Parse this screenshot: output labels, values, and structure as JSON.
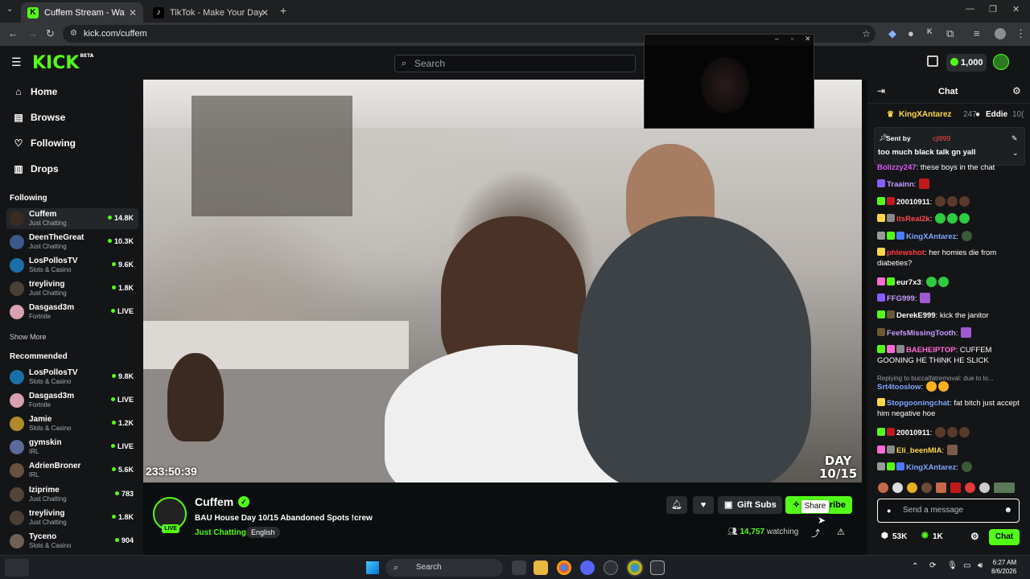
{
  "browser": {
    "tabs": [
      {
        "title": "Cuffem Stream - Watch Live",
        "active": true
      },
      {
        "title": "TikTok - Make Your Day",
        "active": false
      }
    ],
    "url": "kick.com/cuffem"
  },
  "header": {
    "logo": "KICK",
    "logo_tag": "BETA",
    "search_placeholder": "Search",
    "balance": "1,000"
  },
  "sidebar": {
    "nav": [
      {
        "label": "Home",
        "icon": "home-icon"
      },
      {
        "label": "Browse",
        "icon": "browse-icon"
      },
      {
        "label": "Following",
        "icon": "heart-icon"
      },
      {
        "label": "Drops",
        "icon": "drops-icon"
      }
    ],
    "following_title": "Following",
    "following": [
      {
        "name": "Cuffem",
        "category": "Just Chatting",
        "viewers": "14.8K"
      },
      {
        "name": "DeenTheGreat",
        "category": "Just Chatting",
        "viewers": "10.3K"
      },
      {
        "name": "LosPollosTV",
        "category": "Slots & Casino",
        "viewers": "9.6K"
      },
      {
        "name": "treyliving",
        "category": "Just Chatting",
        "viewers": "1.8K"
      },
      {
        "name": "Dasgasd3m",
        "category": "Fortnite",
        "viewers": "LIVE"
      }
    ],
    "show_more": "Show More",
    "recommended_title": "Recommended",
    "recommended": [
      {
        "name": "LosPollosTV",
        "category": "Slots & Casino",
        "viewers": "9.8K"
      },
      {
        "name": "Dasgasd3m",
        "category": "Fortnite",
        "viewers": "LIVE"
      },
      {
        "name": "Jamie",
        "category": "Slots & Casino",
        "viewers": "1.2K"
      },
      {
        "name": "gymskin",
        "category": "IRL",
        "viewers": "LIVE"
      },
      {
        "name": "AdrienBroner",
        "category": "IRL",
        "viewers": "5.6K"
      },
      {
        "name": "Iziprime",
        "category": "Just Chatting",
        "viewers": "783"
      },
      {
        "name": "treyliving",
        "category": "Just Chatting",
        "viewers": "1.8K"
      },
      {
        "name": "Tyceno",
        "category": "Slots & Casino",
        "viewers": "904"
      }
    ]
  },
  "video": {
    "uptime": "233:50:39",
    "overlay_day": "DAY",
    "overlay_count": "10/15"
  },
  "stream": {
    "channel": "Cuffem",
    "live_badge": "LIVE",
    "title": "BAU House Day 10/15 Abandoned Spots !crew",
    "category": "Just Chatting",
    "language": "English",
    "gift_label": "Gift Subs",
    "subscribe_label": "ribe",
    "share_tooltip": "Share",
    "viewers": "14,757",
    "viewers_suffix": "watching"
  },
  "chat": {
    "title": "Chat",
    "top_gifters": [
      {
        "name": "KingXAntarez",
        "count": "247"
      },
      {
        "name": "Eddie",
        "count": "10("
      }
    ],
    "pinned": {
      "sent_by": "Sent by",
      "user": "cjl999",
      "text": "too much black talk gn yall"
    },
    "messages": [
      {
        "user": "Bolizzy247",
        "text": "these boys in the chat",
        "color": "#e05cff"
      },
      {
        "user": "Traainn",
        "text": "",
        "color": "#c49cff"
      },
      {
        "user": "20010911",
        "text": "",
        "color": "#ffffff"
      },
      {
        "user": "itsReal2k",
        "text": "",
        "color": "#ff4a4a"
      },
      {
        "user": "KingXAntarez",
        "text": "",
        "color": "#7ea6ff"
      },
      {
        "user": "phlewshot",
        "text": "her homies die from diabeties?",
        "color": "#ff3b3b"
      },
      {
        "user": "eur7x3",
        "text": "",
        "color": "#ffffff"
      },
      {
        "user": "FFG999",
        "text": "",
        "color": "#c49cff"
      },
      {
        "user": "DerekE999",
        "text": "kick the janitor",
        "color": "#ffffff"
      },
      {
        "user": "FeefsMissingTooth",
        "text": "",
        "color": "#c49cff"
      },
      {
        "user": "BAEHEIPTOP",
        "text": "CUFFEM GOONING HE THINK HE SLICK",
        "color": "#ff6ad5"
      },
      {
        "user": "Srt4tooslow",
        "text": "",
        "color": "#7ea6ff"
      },
      {
        "user": "Stopgooningchat",
        "text": "fat bitch just accept him negative hoe",
        "color": "#7ea6ff"
      },
      {
        "user": "20010911",
        "text": "",
        "color": "#ffffff"
      },
      {
        "user": "Eli_beenMIA",
        "text": "",
        "color": "#ffd84a"
      },
      {
        "user": "KingXAntarez",
        "text": "",
        "color": "#7ea6ff"
      }
    ],
    "reply_hint": "Replying to buccalfatremoval: due to lo...",
    "input_placeholder": "Send a message",
    "footer_points": "53K",
    "footer_kicks": "1K",
    "send_label": "Chat"
  },
  "taskbar": {
    "search": "Search",
    "time": "6:27 AM",
    "date": "8/6/2026"
  },
  "colors": {
    "brand": "#53fc18",
    "background": "#0b0e0f",
    "panel": "#141517"
  }
}
